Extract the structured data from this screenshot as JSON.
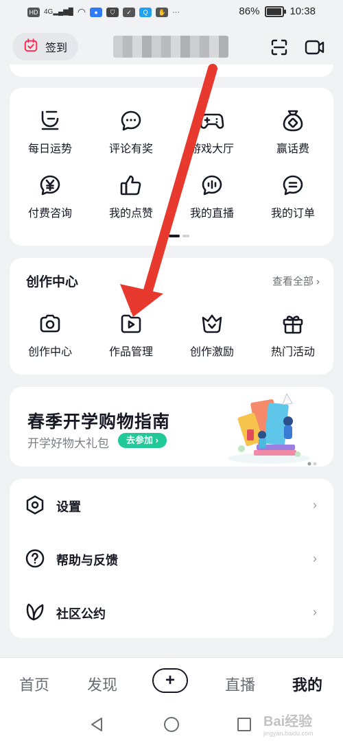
{
  "status_bar": {
    "left_chips": [
      "HD",
      "4G",
      "✓",
      "Q"
    ],
    "battery_text": "86%",
    "battery_level": 0.86,
    "time": "10:38"
  },
  "header": {
    "checkin_label": "签到",
    "scan_icon": "scan-icon",
    "video_icon": "video-camera-icon"
  },
  "services": [
    {
      "label": "每日运势",
      "icon": "fortune-icon"
    },
    {
      "label": "评论有奖",
      "icon": "comment-icon"
    },
    {
      "label": "游戏大厅",
      "icon": "gamepad-icon"
    },
    {
      "label": "赢话费",
      "icon": "money-bag-icon"
    },
    {
      "label": "付费咨询",
      "icon": "yen-icon"
    },
    {
      "label": "我的点赞",
      "icon": "thumbs-up-icon"
    },
    {
      "label": "我的直播",
      "icon": "live-icon"
    },
    {
      "label": "我的订单",
      "icon": "order-icon"
    }
  ],
  "creation": {
    "title": "创作中心",
    "more": "查看全部",
    "items": [
      {
        "label": "创作中心",
        "icon": "camera-icon"
      },
      {
        "label": "作品管理",
        "icon": "video-folder-icon"
      },
      {
        "label": "创作激励",
        "icon": "crown-icon"
      },
      {
        "label": "热门活动",
        "icon": "gift-icon"
      }
    ]
  },
  "banner": {
    "title": "春季开学购物指南",
    "subtitle": "开学好物大礼包",
    "join": "去参加 ›"
  },
  "settings_list": [
    {
      "label": "设置",
      "icon": "settings-hexagon-icon"
    },
    {
      "label": "帮助与反馈",
      "icon": "help-icon"
    },
    {
      "label": "社区公约",
      "icon": "leaf-icon"
    }
  ],
  "bottom_nav": {
    "home": "首页",
    "discover": "发现",
    "plus": "+",
    "live": "直播",
    "me": "我的"
  },
  "watermark": {
    "text": "Bai经验",
    "url": "jingyan.baidu.com"
  },
  "colors": {
    "accent_green": "#20c997",
    "arrow_red": "#e8392f",
    "text": "#161823"
  }
}
